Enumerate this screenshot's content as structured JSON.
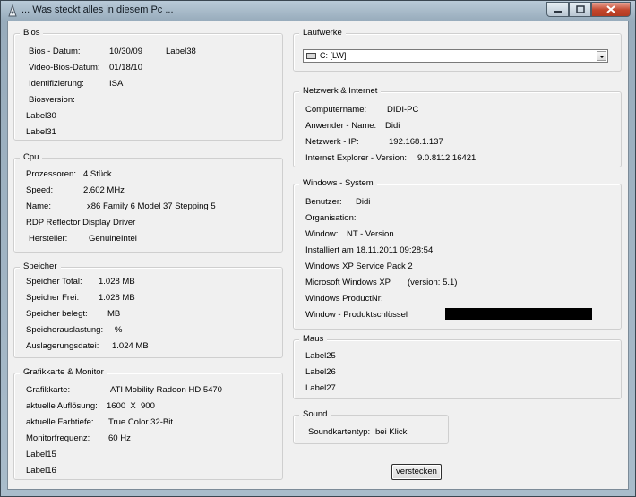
{
  "window": {
    "title": "... Was steckt alles in diesem Pc ...",
    "icons": [
      "app-icon",
      "minimize-icon",
      "maximize-icon",
      "close-icon"
    ]
  },
  "bios": {
    "title": "Bios",
    "datum_label": "Bios - Datum:",
    "datum_value": "10/30/09",
    "label38": "Label38",
    "video_label": "Video-Bios-Datum:",
    "video_value": "01/18/10",
    "ident_label": "Identifizierung:",
    "ident_value": "ISA",
    "version_label": "Biosversion:",
    "label30": "Label30",
    "label31": "Label31"
  },
  "cpu": {
    "title": "Cpu",
    "proz_label": "Prozessoren:",
    "proz_value": "4 Stück",
    "speed_label": "Speed:",
    "speed_value": "2.602 MHz",
    "name_label": "Name:",
    "name_value": "x86 Family 6 Model 37 Stepping 5",
    "rdp": "RDP Reflector Display Driver",
    "herst_label": "Hersteller:",
    "herst_value": "GenuineIntel"
  },
  "speicher": {
    "title": "Speicher",
    "total_label": "Speicher Total:",
    "total_value": "1.028 MB",
    "frei_label": "Speicher Frei:",
    "frei_value": "1.028 MB",
    "belegt_label": "Speicher belegt:",
    "belegt_value": "MB",
    "ausl_label": "Speicherauslastung:",
    "ausl_value": "%",
    "datei_label": "Auslagerungsdatei:",
    "datei_value": "1.024 MB"
  },
  "grafik": {
    "title": "Grafikkarte & Monitor",
    "karte_label": "Grafikkarte:",
    "karte_value": "ATI Mobility Radeon HD 5470",
    "aufl_label": "aktuelle Auflösung:",
    "aufl_value": "1600  X  900",
    "farb_label": "aktuelle Farbtiefe:",
    "farb_value": "True Color 32-Bit",
    "freq_label": "Monitorfrequenz:",
    "freq_value": "60 Hz",
    "label15": "Label15",
    "label16": "Label16"
  },
  "laufwerke": {
    "title": "Laufwerke",
    "selected": "C: [LW]"
  },
  "netzwerk": {
    "title": "Netzwerk  &  Internet",
    "comp_label": "Computername:",
    "comp_value": "DIDI-PC",
    "anw_label": "Anwender - Name:",
    "anw_value": "Didi",
    "ip_label": "Netzwerk - IP:",
    "ip_value": "192.168.1.137",
    "ie_label": "Internet Explorer - Version:",
    "ie_value": "9.0.8112.16421"
  },
  "windows": {
    "title": "Windows - System",
    "benutzer_label": "Benutzer:",
    "benutzer_value": "Didi",
    "org_label": "Organisation:",
    "window_label": "Window:",
    "window_value": "NT - Version",
    "installiert": "Installiert am 18.11.2011  09:28:54",
    "sp": "Windows XP Service Pack 2",
    "ms_label": "Microsoft Windows XP",
    "ms_version": "(version: 5.1)",
    "productnr_label": "Windows ProductNr:",
    "produktschl_label": "Window - Produktschlüssel"
  },
  "maus": {
    "title": "Maus",
    "label25": "Label25",
    "label26": "Label26",
    "label27": "Label27"
  },
  "sound": {
    "title": "Sound",
    "typ_label": "Soundkartentyp:",
    "typ_value": "bei Klick"
  },
  "button": {
    "verstecken": "verstecken"
  }
}
